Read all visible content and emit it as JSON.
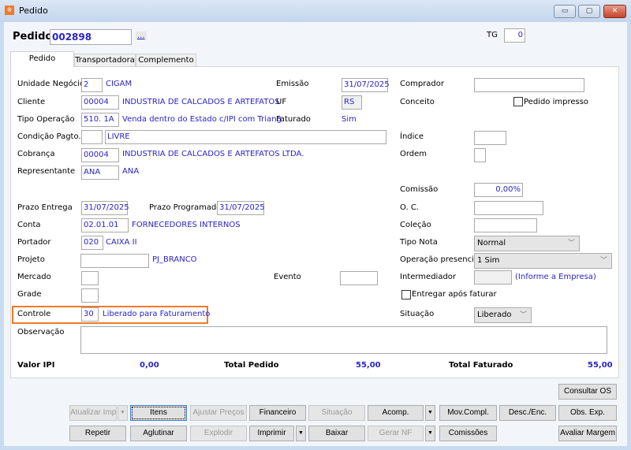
{
  "window": {
    "title": "Pedido",
    "minimize": "▭",
    "maximize": "▢",
    "close": "✕"
  },
  "header": {
    "pedido_label": "Pedido",
    "pedido_value": "002898",
    "lookup": "...",
    "tg_label": "TG",
    "tg_value": "0"
  },
  "tabs": [
    {
      "label": "Pedido",
      "active": true
    },
    {
      "label": "Transportadora"
    },
    {
      "label": "Complemento"
    }
  ],
  "form": {
    "unidade": {
      "label": "Unidade Negócio",
      "code": "2",
      "desc": "CIGAM"
    },
    "cliente": {
      "label": "Cliente",
      "code": "00004",
      "desc": "INDUSTRIA DE CALCADOS E ARTEFATOS"
    },
    "tipo_operacao": {
      "label": "Tipo Operação",
      "code": "510. 1A",
      "desc": "Venda dentro do Estado c/IPI com Triang"
    },
    "condicao": {
      "label": "Condição Pagto.",
      "code": "",
      "desc": "LIVRE"
    },
    "cobranca": {
      "label": "Cobrança",
      "code": "00004",
      "desc": "INDUSTRIA DE CALCADOS E ARTEFATOS LTDA."
    },
    "representante": {
      "label": "Representante",
      "code": "ANA",
      "desc": "ANA"
    },
    "emissao": {
      "label": "Emissão",
      "value": "31/07/2025"
    },
    "uf": {
      "label": "UF",
      "value": "RS"
    },
    "faturado": {
      "label": "Faturado",
      "value": "Sim"
    },
    "prazo_entrega": {
      "label": "Prazo Entrega",
      "value": "31/07/2025"
    },
    "prazo_programado": {
      "label": "Prazo Programado",
      "value": "31/07/2025"
    },
    "conta": {
      "label": "Conta",
      "code": "02.01.01",
      "desc": "FORNECEDORES INTERNOS"
    },
    "portador": {
      "label": "Portador",
      "code": "020",
      "desc": "CAIXA II"
    },
    "projeto": {
      "label": "Projeto",
      "code": "",
      "desc": "PJ_BRANCO"
    },
    "mercado": {
      "label": "Mercado",
      "value": ""
    },
    "evento": {
      "label": "Evento",
      "value": ""
    },
    "grade": {
      "label": "Grade",
      "value": ""
    },
    "controle": {
      "label": "Controle",
      "code": "30",
      "desc": "Liberado para Faturamento",
      "highlight_color": "#f07a2a"
    },
    "observacao": {
      "label": "Observação",
      "value": ""
    },
    "comprador": {
      "label": "Comprador",
      "value": ""
    },
    "conceito": {
      "label": "Conceito"
    },
    "pedido_impresso": {
      "label": "Pedido impresso",
      "checked": false
    },
    "indice": {
      "label": "Índice",
      "value": ""
    },
    "ordem": {
      "label": "Ordem",
      "value": ""
    },
    "comissao": {
      "label": "Comissão",
      "value": "0,00%"
    },
    "oc": {
      "label": "O. C.",
      "value": ""
    },
    "colecao": {
      "label": "Coleção",
      "value": ""
    },
    "tipo_nota": {
      "label": "Tipo Nota",
      "value": "Normal"
    },
    "operacao_presencial": {
      "label": "Operação presencial",
      "value": "1 Sim"
    },
    "intermediador": {
      "label": "Intermediador",
      "value": "",
      "hint": "(Informe a Empresa)"
    },
    "entregar": {
      "label": "Entregar após faturar",
      "checked": false
    },
    "situacao": {
      "label": "Situação",
      "value": "Liberado"
    }
  },
  "totals": {
    "ipi_label": "Valor IPI",
    "ipi": "0,00",
    "pedido_label": "Total Pedido",
    "pedido": "55,00",
    "faturado_label": "Total Faturado",
    "faturado": "55,00"
  },
  "buttons": {
    "consultar_os": "Consultar OS",
    "atualizar_imp": "Atualizar Imp",
    "itens": "Itens",
    "ajustar_precos": "Ajustar Preços",
    "financeiro": "Financeiro",
    "situacao": "Situação",
    "acomp": "Acomp.",
    "mov_compl": "Mov.Compl.",
    "desc_enc": "Desc./Enc.",
    "obs_exp": "Obs. Exp.",
    "repetir": "Repetir",
    "aglutinar": "Aglutinar",
    "explodir": "Explodir",
    "imprimir": "Imprimir",
    "baixar": "Baixar",
    "gerar_nf": "Gerar NF",
    "comissoes": "Comissões",
    "avaliar_margem": "Avaliar Margem",
    "dropdown": "▼"
  }
}
